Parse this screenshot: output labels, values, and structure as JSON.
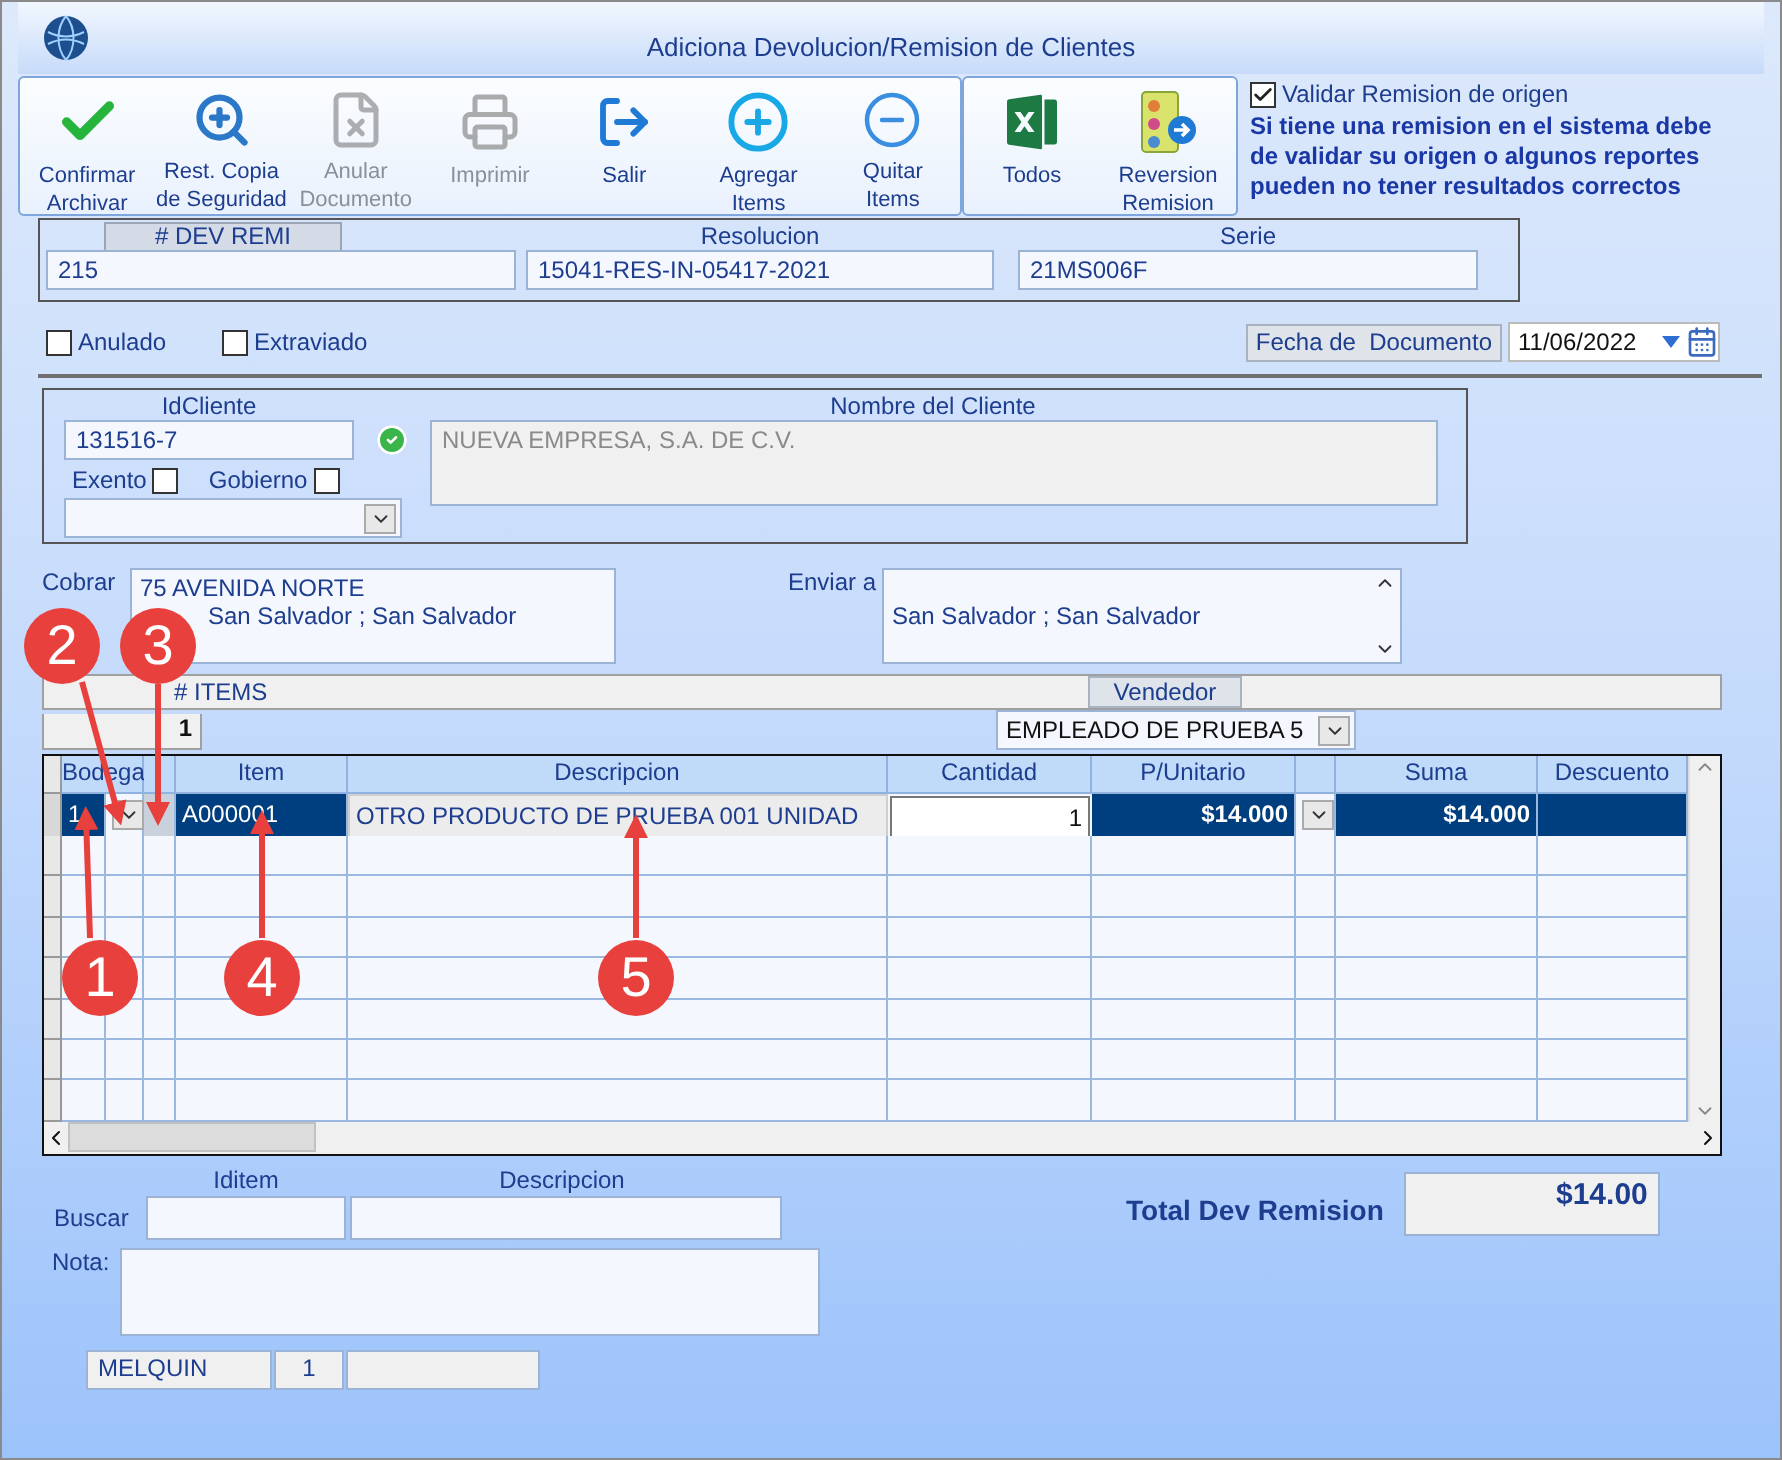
{
  "window": {
    "title": "Adiciona Devolucion/Remision de Clientes"
  },
  "toolbar": {
    "groups": [
      [
        {
          "label": "Confirmar\nArchivar",
          "disabled": false
        },
        {
          "label": "Rest. Copia\nde Seguridad",
          "disabled": false
        },
        {
          "label": "Anular\nDocumento",
          "disabled": true
        },
        {
          "label": "Imprimir",
          "disabled": true
        },
        {
          "label": "Salir",
          "disabled": false
        },
        {
          "label": "Agregar\nItems",
          "disabled": false
        },
        {
          "label": "Quitar\nItems",
          "disabled": false
        }
      ],
      [
        {
          "label": "Todos",
          "disabled": false
        },
        {
          "label": "Reversion\nRemision",
          "disabled": false
        }
      ]
    ]
  },
  "validation": {
    "label": "Validar Remision de origen",
    "checked": true,
    "warning": "Si tiene una remision en el sistema debe\nde validar su origen o algunos reportes\npueden no tener resultados correctos"
  },
  "document": {
    "fields": [
      {
        "label": "# DEV REMI",
        "kind": "tab",
        "value": "215"
      },
      {
        "label": "Resolucion",
        "kind": "plain",
        "value": "15041-RES-IN-05417-2021"
      },
      {
        "label": "Serie",
        "kind": "plain",
        "value": "21MS006F"
      }
    ]
  },
  "flags": [
    {
      "label": "Anulado",
      "checked": false
    },
    {
      "label": "Extraviado",
      "checked": false
    }
  ],
  "date": {
    "label": "Fecha de  Documento",
    "value": "11/06/2022"
  },
  "client": {
    "id_label": "IdCliente",
    "id": "131516-7",
    "name_label": "Nombre del Cliente",
    "name": "NUEVA EMPRESA, S.A. DE C.V.",
    "options": [
      {
        "label": "Exento",
        "checked": false
      },
      {
        "label": "Gobierno",
        "checked": false
      }
    ]
  },
  "addresses": [
    {
      "label": "Cobrar",
      "lines": [
        "75 AVENIDA NORTE",
        "San Salvador ; San Salvador"
      ],
      "scrollable": false
    },
    {
      "label": "Enviar a",
      "lines": [
        "San Salvador ; San Salvador"
      ],
      "scrollable": true
    }
  ],
  "items_bar": {
    "label": "# ITEMS",
    "vendor_label": "Vendedor",
    "page": "1",
    "vendor": "EMPLEADO DE PRUEBA 5"
  },
  "grid": {
    "columns": [
      {
        "kind": "text",
        "header": "Bodega"
      },
      {
        "kind": "combo"
      },
      {
        "kind": "blank"
      },
      {
        "kind": "text",
        "header": "Item"
      },
      {
        "kind": "desc",
        "header": "Descripcion"
      },
      {
        "kind": "input",
        "header": "Cantidad"
      },
      {
        "kind": "amount",
        "header": "P/Unitario"
      },
      {
        "kind": "combo"
      },
      {
        "kind": "amount",
        "header": "Suma"
      },
      {
        "kind": "text",
        "header": "Descuento"
      }
    ],
    "rows": [
      {
        "selected": true,
        "values": [
          "1",
          "A000001",
          "OTRO PRODUCTO DE PRUEBA 001 UNIDAD",
          "1",
          "$14.000",
          "$14.000"
        ]
      }
    ]
  },
  "search": {
    "label": "Buscar",
    "columns": [
      "Iditem",
      "Descripcion"
    ]
  },
  "note": {
    "label": "Nota:"
  },
  "footer_fields": [
    "MELQUIN",
    "1"
  ],
  "total": {
    "label": "Total Dev Remision",
    "value": "$14.00"
  },
  "callouts": [
    {
      "number": "2"
    },
    {
      "number": "3"
    },
    {
      "number": "1"
    },
    {
      "number": "4"
    },
    {
      "number": "5"
    }
  ]
}
